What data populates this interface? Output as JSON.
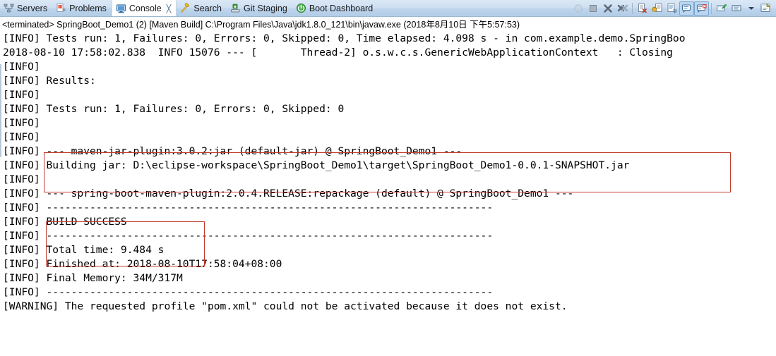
{
  "tabbar": {
    "tabs": [
      {
        "label": "Servers",
        "icon": "servers-icon",
        "active": false,
        "closable": false
      },
      {
        "label": "Problems",
        "icon": "problems-icon",
        "active": false,
        "closable": false
      },
      {
        "label": "Console",
        "icon": "console-icon",
        "active": true,
        "closable": true,
        "close_glyph": "╳"
      },
      {
        "label": "Search",
        "icon": "search-icon",
        "active": false,
        "closable": false
      },
      {
        "label": "Git Staging",
        "icon": "git-staging-icon",
        "active": false,
        "closable": false
      },
      {
        "label": "Boot Dashboard",
        "icon": "boot-dashboard-icon",
        "active": false,
        "closable": false
      }
    ],
    "toolbar": [
      {
        "name": "terminate-all-icon",
        "type": "icon"
      },
      {
        "name": "terminate-icon",
        "type": "icon"
      },
      {
        "name": "remove-launch-icon",
        "type": "icon"
      },
      {
        "name": "remove-all-terminated-icon",
        "type": "icon"
      },
      {
        "name": "separator-1",
        "type": "separator"
      },
      {
        "name": "clear-console-icon",
        "type": "icon"
      },
      {
        "name": "scroll-lock-icon",
        "type": "icon"
      },
      {
        "name": "word-wrap-icon",
        "type": "icon"
      },
      {
        "name": "show-console-on-output-icon",
        "type": "icon",
        "pressed": true
      },
      {
        "name": "show-console-on-error-icon",
        "type": "icon",
        "pressed": true
      },
      {
        "name": "separator-2",
        "type": "separator"
      },
      {
        "name": "pin-console-icon",
        "type": "icon"
      },
      {
        "name": "display-selected-console-icon",
        "type": "icon"
      },
      {
        "name": "chevron-down-icon",
        "type": "arrow"
      },
      {
        "name": "open-console-icon",
        "type": "icon"
      }
    ]
  },
  "launch": {
    "title": "<terminated> SpringBoot_Demo1 (2) [Maven Build] C:\\Program Files\\Java\\jdk1.8.0_121\\bin\\javaw.exe (2018年8月10日 下午5:57:53)"
  },
  "console": {
    "lines": [
      "[INFO] Tests run: 1, Failures: 0, Errors: 0, Skipped: 0, Time elapsed: 4.098 s - in com.example.demo.SpringBoo",
      "2018-08-10 17:58:02.838  INFO 15076 --- [       Thread-2] o.s.w.c.s.GenericWebApplicationContext   : Closing ",
      "[INFO] ",
      "[INFO] Results:",
      "[INFO] ",
      "[INFO] Tests run: 1, Failures: 0, Errors: 0, Skipped: 0",
      "[INFO] ",
      "[INFO] ",
      "[INFO] --- maven-jar-plugin:3.0.2:jar (default-jar) @ SpringBoot_Demo1 ---",
      "[INFO] Building jar: D:\\eclipse-workspace\\SpringBoot_Demo1\\target\\SpringBoot_Demo1-0.0.1-SNAPSHOT.jar",
      "[INFO] ",
      "[INFO] --- spring-boot-maven-plugin:2.0.4.RELEASE:repackage (default) @ SpringBoot_Demo1 ---",
      "[INFO] ------------------------------------------------------------------------",
      "[INFO] BUILD SUCCESS",
      "[INFO] ------------------------------------------------------------------------",
      "[INFO] Total time: 9.484 s",
      "[INFO] Finished at: 2018-08-10T17:58:04+08:00",
      "[INFO] Final Memory: 34M/317M",
      "[INFO] ------------------------------------------------------------------------",
      "[WARNING] The requested profile \"pom.xml\" could not be activated because it does not exist."
    ]
  },
  "annotations": [
    {
      "name": "jar-build-highlight",
      "color": "#c0392b"
    },
    {
      "name": "build-success-highlight",
      "color": "#c0392b"
    }
  ]
}
